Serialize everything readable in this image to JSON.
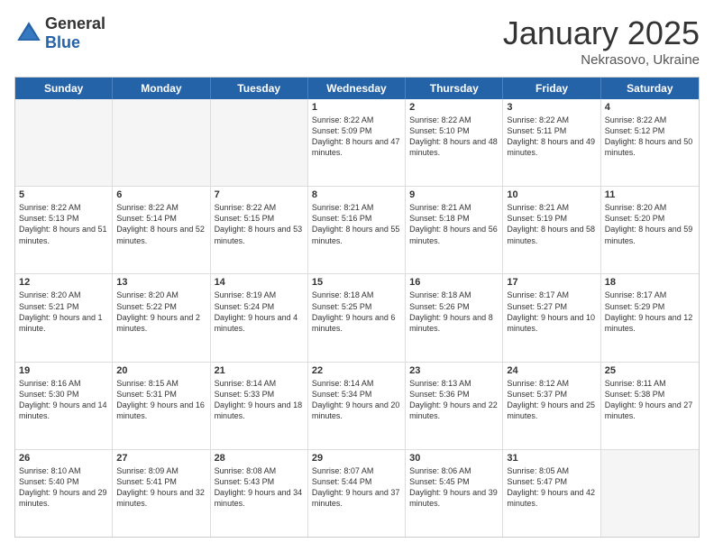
{
  "logo": {
    "general": "General",
    "blue": "Blue"
  },
  "title": "January 2025",
  "subtitle": "Nekrasovo, Ukraine",
  "days": [
    "Sunday",
    "Monday",
    "Tuesday",
    "Wednesday",
    "Thursday",
    "Friday",
    "Saturday"
  ],
  "weeks": [
    [
      {
        "day": "",
        "info": ""
      },
      {
        "day": "",
        "info": ""
      },
      {
        "day": "",
        "info": ""
      },
      {
        "day": "1",
        "info": "Sunrise: 8:22 AM\nSunset: 5:09 PM\nDaylight: 8 hours and 47 minutes."
      },
      {
        "day": "2",
        "info": "Sunrise: 8:22 AM\nSunset: 5:10 PM\nDaylight: 8 hours and 48 minutes."
      },
      {
        "day": "3",
        "info": "Sunrise: 8:22 AM\nSunset: 5:11 PM\nDaylight: 8 hours and 49 minutes."
      },
      {
        "day": "4",
        "info": "Sunrise: 8:22 AM\nSunset: 5:12 PM\nDaylight: 8 hours and 50 minutes."
      }
    ],
    [
      {
        "day": "5",
        "info": "Sunrise: 8:22 AM\nSunset: 5:13 PM\nDaylight: 8 hours and 51 minutes."
      },
      {
        "day": "6",
        "info": "Sunrise: 8:22 AM\nSunset: 5:14 PM\nDaylight: 8 hours and 52 minutes."
      },
      {
        "day": "7",
        "info": "Sunrise: 8:22 AM\nSunset: 5:15 PM\nDaylight: 8 hours and 53 minutes."
      },
      {
        "day": "8",
        "info": "Sunrise: 8:21 AM\nSunset: 5:16 PM\nDaylight: 8 hours and 55 minutes."
      },
      {
        "day": "9",
        "info": "Sunrise: 8:21 AM\nSunset: 5:18 PM\nDaylight: 8 hours and 56 minutes."
      },
      {
        "day": "10",
        "info": "Sunrise: 8:21 AM\nSunset: 5:19 PM\nDaylight: 8 hours and 58 minutes."
      },
      {
        "day": "11",
        "info": "Sunrise: 8:20 AM\nSunset: 5:20 PM\nDaylight: 8 hours and 59 minutes."
      }
    ],
    [
      {
        "day": "12",
        "info": "Sunrise: 8:20 AM\nSunset: 5:21 PM\nDaylight: 9 hours and 1 minute."
      },
      {
        "day": "13",
        "info": "Sunrise: 8:20 AM\nSunset: 5:22 PM\nDaylight: 9 hours and 2 minutes."
      },
      {
        "day": "14",
        "info": "Sunrise: 8:19 AM\nSunset: 5:24 PM\nDaylight: 9 hours and 4 minutes."
      },
      {
        "day": "15",
        "info": "Sunrise: 8:18 AM\nSunset: 5:25 PM\nDaylight: 9 hours and 6 minutes."
      },
      {
        "day": "16",
        "info": "Sunrise: 8:18 AM\nSunset: 5:26 PM\nDaylight: 9 hours and 8 minutes."
      },
      {
        "day": "17",
        "info": "Sunrise: 8:17 AM\nSunset: 5:27 PM\nDaylight: 9 hours and 10 minutes."
      },
      {
        "day": "18",
        "info": "Sunrise: 8:17 AM\nSunset: 5:29 PM\nDaylight: 9 hours and 12 minutes."
      }
    ],
    [
      {
        "day": "19",
        "info": "Sunrise: 8:16 AM\nSunset: 5:30 PM\nDaylight: 9 hours and 14 minutes."
      },
      {
        "day": "20",
        "info": "Sunrise: 8:15 AM\nSunset: 5:31 PM\nDaylight: 9 hours and 16 minutes."
      },
      {
        "day": "21",
        "info": "Sunrise: 8:14 AM\nSunset: 5:33 PM\nDaylight: 9 hours and 18 minutes."
      },
      {
        "day": "22",
        "info": "Sunrise: 8:14 AM\nSunset: 5:34 PM\nDaylight: 9 hours and 20 minutes."
      },
      {
        "day": "23",
        "info": "Sunrise: 8:13 AM\nSunset: 5:36 PM\nDaylight: 9 hours and 22 minutes."
      },
      {
        "day": "24",
        "info": "Sunrise: 8:12 AM\nSunset: 5:37 PM\nDaylight: 9 hours and 25 minutes."
      },
      {
        "day": "25",
        "info": "Sunrise: 8:11 AM\nSunset: 5:38 PM\nDaylight: 9 hours and 27 minutes."
      }
    ],
    [
      {
        "day": "26",
        "info": "Sunrise: 8:10 AM\nSunset: 5:40 PM\nDaylight: 9 hours and 29 minutes."
      },
      {
        "day": "27",
        "info": "Sunrise: 8:09 AM\nSunset: 5:41 PM\nDaylight: 9 hours and 32 minutes."
      },
      {
        "day": "28",
        "info": "Sunrise: 8:08 AM\nSunset: 5:43 PM\nDaylight: 9 hours and 34 minutes."
      },
      {
        "day": "29",
        "info": "Sunrise: 8:07 AM\nSunset: 5:44 PM\nDaylight: 9 hours and 37 minutes."
      },
      {
        "day": "30",
        "info": "Sunrise: 8:06 AM\nSunset: 5:45 PM\nDaylight: 9 hours and 39 minutes."
      },
      {
        "day": "31",
        "info": "Sunrise: 8:05 AM\nSunset: 5:47 PM\nDaylight: 9 hours and 42 minutes."
      },
      {
        "day": "",
        "info": ""
      }
    ]
  ]
}
